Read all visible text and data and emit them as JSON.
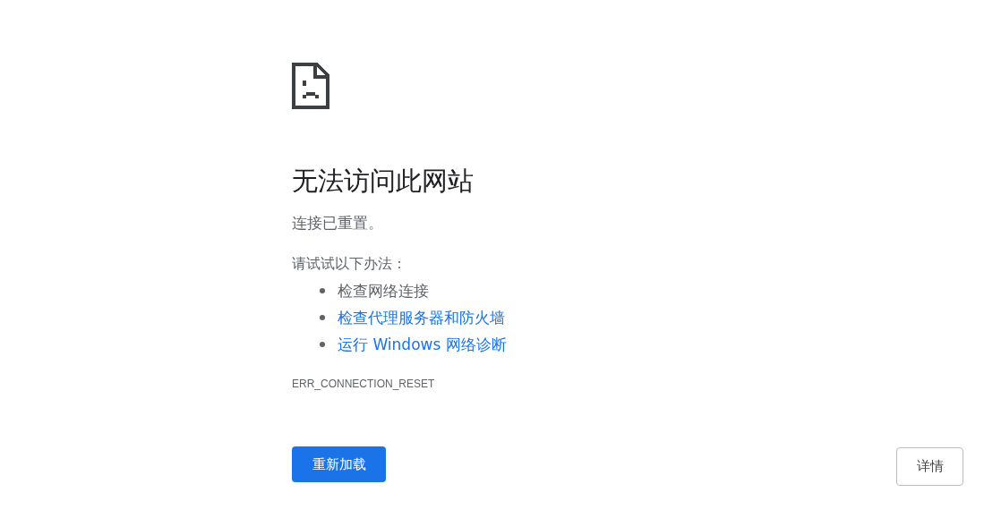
{
  "title": "无法访问此网站",
  "message": "连接已重置。",
  "suggestions_heading": "请试试以下办法：",
  "suggestions": [
    {
      "kind": "text",
      "text": "检查网络连接"
    },
    {
      "kind": "link",
      "text": "检查代理服务器和防火墙"
    },
    {
      "kind": "link",
      "text": "运行 Windows 网络诊断"
    }
  ],
  "error_code": "ERR_CONNECTION_RESET",
  "buttons": {
    "reload": "重新加载",
    "details": "详情"
  }
}
